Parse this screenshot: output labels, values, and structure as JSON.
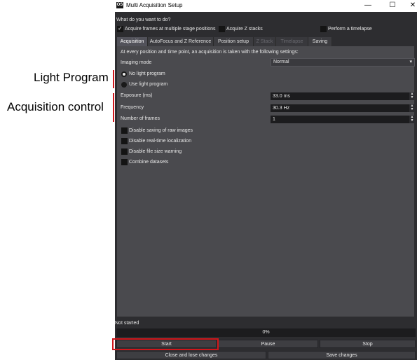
{
  "annotations": {
    "light_program": "Light Program",
    "acquisition_control": "Acquisition control",
    "accent_color": "#d0161b"
  },
  "window": {
    "title": "Multi Acquisition Setup",
    "app_icon": "app-logo",
    "controls": {
      "minimize": "—",
      "maximize": "☐",
      "close": "✕"
    }
  },
  "header": {
    "question": "What do you want to do?",
    "options": [
      {
        "label": "Acquire frames at multiple stage positions",
        "checked": true
      },
      {
        "label": "Acquire Z stacks",
        "checked": false
      },
      {
        "label": "Perform a timelapse",
        "checked": false
      }
    ]
  },
  "tabs": [
    {
      "label": "Acquisition",
      "state": "active"
    },
    {
      "label": "AutoFocus and Z Reference",
      "state": "enabled"
    },
    {
      "label": "Position setup",
      "state": "enabled"
    },
    {
      "label": "Z Stack",
      "state": "disabled"
    },
    {
      "label": "Timelapse",
      "state": "disabled"
    },
    {
      "label": "Saving",
      "state": "enabled"
    }
  ],
  "acquisition": {
    "intro": "At every position and time point, an acquisition is taken with the following settings:",
    "imaging_mode_label": "Imaging mode",
    "imaging_mode_value": "Normal",
    "light_options": [
      {
        "label": "No light program",
        "selected": true
      },
      {
        "label": "Use light program",
        "selected": false
      }
    ],
    "exposure_label": "Exposure (ms)",
    "exposure_value": "33.0 ms",
    "frequency_label": "Frequency",
    "frequency_value": "30.3 Hz",
    "frames_label": "Number of frames",
    "frames_value": "1",
    "checkboxes": [
      {
        "label": "Disable saving of raw images",
        "checked": false
      },
      {
        "label": "Disable real-time localization",
        "checked": false
      },
      {
        "label": "Disable file size warning",
        "checked": false
      },
      {
        "label": "Combine datasets",
        "checked": false
      }
    ]
  },
  "footer": {
    "status": "Not started",
    "progress_text": "0%",
    "progress_value": 0,
    "start": "Start",
    "pause": "Pause",
    "stop": "Stop",
    "close_lose": "Close and lose changes",
    "save": "Save changes"
  }
}
